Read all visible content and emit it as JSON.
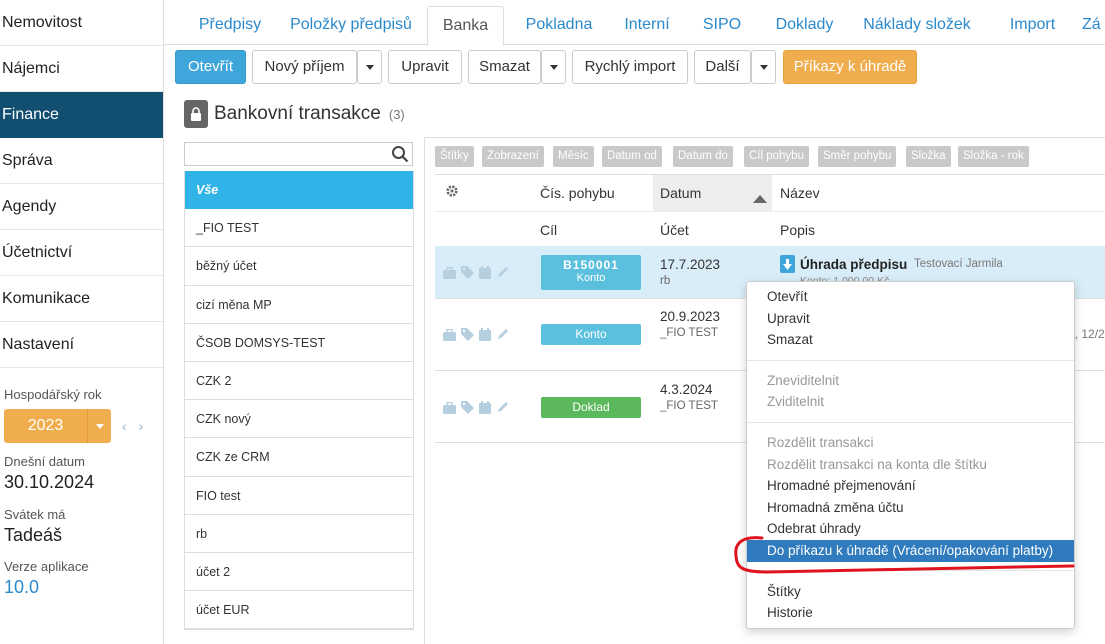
{
  "sidebar": {
    "items": [
      {
        "label": "Nemovitost"
      },
      {
        "label": "Nájemci"
      },
      {
        "label": "Finance",
        "active": true
      },
      {
        "label": "Správa"
      },
      {
        "label": "Agendy"
      },
      {
        "label": "Účetnictví"
      },
      {
        "label": "Komunikace"
      },
      {
        "label": "Nastavení"
      }
    ],
    "fiscal_year_label": "Hospodářský rok",
    "fiscal_year_value": "2023",
    "fiscal_year_nav": "‹ ›",
    "today_label": "Dnešní datum",
    "today_value": "30.10.2024",
    "nameday_label": "Svátek má",
    "nameday_value": "Tadeáš",
    "version_label": "Verze aplikace",
    "version_value": "10.0"
  },
  "tabs": [
    {
      "label": "Předpisy"
    },
    {
      "label": "Položky předpisů"
    },
    {
      "label": "Banka",
      "active": true
    },
    {
      "label": "Pokladna"
    },
    {
      "label": "Interní"
    },
    {
      "label": "SIPO"
    },
    {
      "label": "Doklady"
    },
    {
      "label": "Náklady složek"
    },
    {
      "label": "Import"
    },
    {
      "label": "Zá"
    }
  ],
  "toolbar": {
    "open": "Otevřít",
    "new_income": "Nový příjem",
    "edit": "Upravit",
    "delete": "Smazat",
    "quick_import": "Rychlý import",
    "more": "Další",
    "payment_orders": "Příkazy k úhradě"
  },
  "page": {
    "title": "Bankovní transakce",
    "count": "(3)"
  },
  "search": {
    "placeholder": ""
  },
  "accounts": [
    {
      "label": "Vše",
      "active": true
    },
    {
      "label": "_FIO TEST"
    },
    {
      "label": "běžný účet"
    },
    {
      "label": "cizí měna MP"
    },
    {
      "label": "ČSOB DOMSYS-TEST"
    },
    {
      "label": "CZK 2"
    },
    {
      "label": "CZK nový"
    },
    {
      "label": "CZK ze CRM"
    },
    {
      "label": "FIO test"
    },
    {
      "label": "rb"
    },
    {
      "label": "účet 2"
    },
    {
      "label": "účet EUR"
    }
  ],
  "filters": [
    "Štítky",
    "Zobrazení",
    "Měsíc",
    "Datum od",
    "Datum do",
    "Cíl pohybu",
    "Směr pohybu",
    "Složka",
    "Složka - rok"
  ],
  "table": {
    "headers": {
      "mov_no": "Čís. pohybu",
      "date": "Datum",
      "name": "Název",
      "target": "Cíl",
      "account": "Účet",
      "desc": "Popis"
    },
    "rows": [
      {
        "badge_code": "B150001",
        "badge_label": "Konto",
        "badge_color": "#5bc0de",
        "date": "17.7.2023",
        "account": "rb",
        "title": "Úhrada předpisu",
        "person": "Testovací Jarmila",
        "sub": "Konto: 1 000,00 Kč"
      },
      {
        "badge_label": "Konto",
        "badge_color": "#5bc0de",
        "date": "20.9.2023",
        "account": "_FIO TEST",
        "tail": "7, 12/2"
      },
      {
        "badge_label": "Doklad",
        "badge_color": "#5cb85c",
        "date": "4.3.2024",
        "account": "_FIO TEST"
      }
    ]
  },
  "context_menu": {
    "open": "Otevřít",
    "edit": "Upravit",
    "delete": "Smazat",
    "hide": "Zneviditelnit",
    "show": "Zviditelnit",
    "split": "Rozdělit transakci",
    "split_by_tag": "Rozdělit transakci na konta dle štítku",
    "bulk_rename": "Hromadné přejmenování",
    "bulk_account": "Hromadná změna účtu",
    "remove_payments": "Odebrat úhrady",
    "to_payment_order": "Do příkazu k úhradě (Vrácení/opakování platby)",
    "tags": "Štítky",
    "history": "Historie"
  },
  "colors": {
    "accent": "#3fa6dc",
    "nav_active": "#124e70",
    "warning": "#efad4d",
    "highlight": "#2f7bbd",
    "annotation": "#e0141e"
  }
}
